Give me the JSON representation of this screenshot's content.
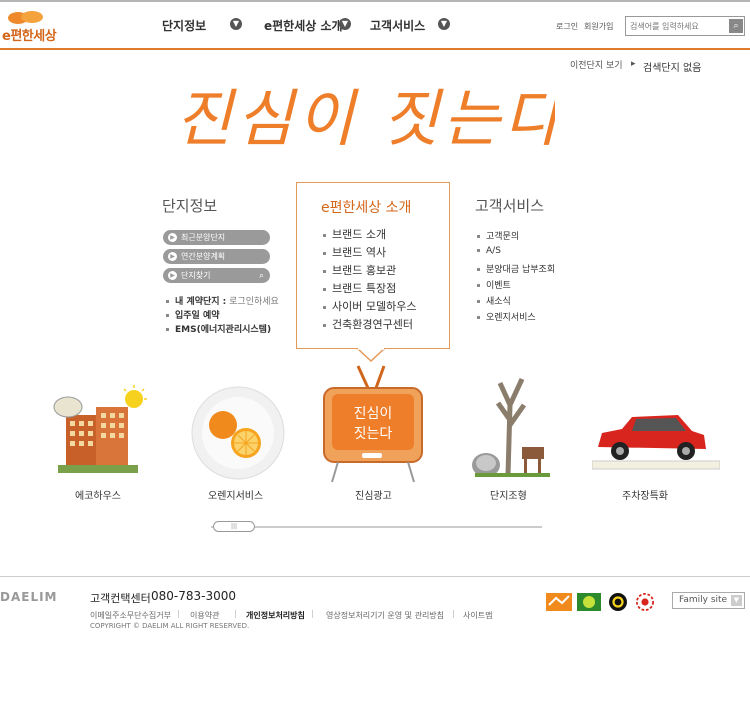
{
  "header": {
    "logo_text": "e편한세상",
    "nav": [
      {
        "label": "단지정보"
      },
      {
        "label": "e편한세상 소개"
      },
      {
        "label": "고객서비스"
      }
    ],
    "login": "로그인",
    "signup": "회원가입",
    "search_placeholder": "검색어를 입력하세요"
  },
  "prev_complex": {
    "link": "이전단지 보기",
    "status": "검색단지 없음"
  },
  "hero": {
    "slogan": "진심이 짓는다"
  },
  "complex_info": {
    "title": "단지정보",
    "pills": [
      "최근분양단지",
      "연간분양계획",
      "단지찾기"
    ],
    "my_contract_label": "내 계약단지 :",
    "my_contract_value": "로그인하세요",
    "items": [
      "입주일 예약",
      "EMS(에너지관리시스템)"
    ]
  },
  "intro": {
    "title": "e편한세상 소개",
    "items": [
      "브랜드 소개",
      "브랜드 역사",
      "브랜드 홍보관",
      "브랜드 특장점",
      "사이버 모델하우스",
      "건축환경연구센터"
    ]
  },
  "customer": {
    "title": "고객서비스",
    "items": [
      "고객문의",
      "A/S",
      "분양대금 납부조회",
      "이벤트",
      "새소식",
      "오렌지서비스"
    ]
  },
  "showcase": [
    {
      "label": "에코하우스"
    },
    {
      "label": "오렌지서비스"
    },
    {
      "label": "진심광고",
      "tv_text": "진심이 짓는다"
    },
    {
      "label": "단지조형"
    },
    {
      "label": "주차장특화"
    }
  ],
  "footer": {
    "brand": "DAELIM",
    "call_center_label": "고객컨택센터",
    "call_center_phone": "080-783-3000",
    "links": [
      "이메일주소무단수집거부",
      "이용약관",
      "개인정보처리방침",
      "영상정보처리기기 운영 및 관리방침",
      "사이트맵"
    ],
    "copyright": "COPYRIGHT © DAELIM  ALL RIGHT RESERVED.",
    "family_site": "Family site"
  },
  "colors": {
    "accent": "#e07a2c",
    "hero": "#ee7e2a",
    "pill": "#9a9a9a"
  }
}
